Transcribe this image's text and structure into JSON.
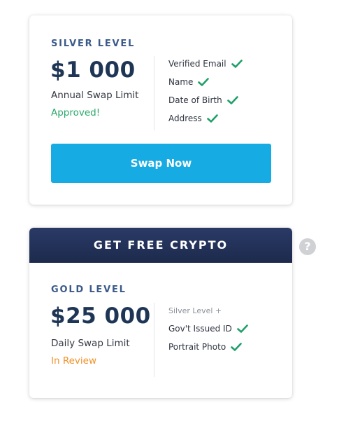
{
  "silver": {
    "title": "SILVER LEVEL",
    "amount": "$1 000",
    "limit_label": "Annual Swap Limit",
    "status": "Approved!",
    "requirements": [
      "Verified Email",
      "Name",
      "Date of Birth",
      "Address"
    ],
    "button_label": "Swap Now"
  },
  "promo": {
    "header": "GET FREE CRYPTO",
    "help_icon": "?"
  },
  "gold": {
    "title": "GOLD LEVEL",
    "amount": "$25 000",
    "limit_label": "Daily Swap Limit",
    "status": "In Review",
    "requirements_heading": "Silver Level +",
    "requirements": [
      "Gov't Issued ID",
      "Portrait Photo"
    ]
  },
  "colors": {
    "accent": "#16abe3",
    "approved": "#2aa86a",
    "review": "#f0922a",
    "header_bg": "#1d2a4d",
    "check": "#1fa06a"
  },
  "icons": {
    "requirement_check": "check-icon",
    "help": "question-circle-icon"
  }
}
